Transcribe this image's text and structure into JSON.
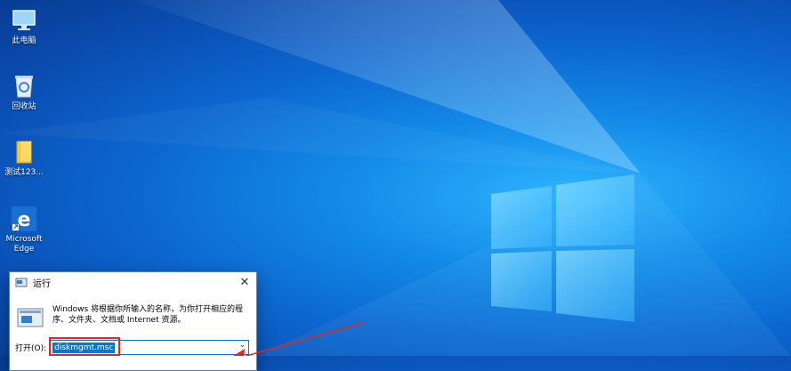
{
  "desktop": {
    "icons": [
      {
        "label": "此电脑",
        "icon": "this-pc-icon"
      },
      {
        "label": "回收站",
        "icon": "recycle-bin-icon"
      },
      {
        "label": "测试123...",
        "icon": "folder-icon"
      },
      {
        "label": "Microsoft Edge",
        "icon": "edge-icon"
      }
    ]
  },
  "run_dialog": {
    "title": "运行",
    "description": "Windows 将根据你所输入的名称，为你打开相应的程序、文件夹、文档或 Internet 资源。",
    "open_label": "打开(O):",
    "input_value": "diskmgmt.msc"
  },
  "colors": {
    "annotation": "#e0281d",
    "accent": "#0078d7"
  }
}
